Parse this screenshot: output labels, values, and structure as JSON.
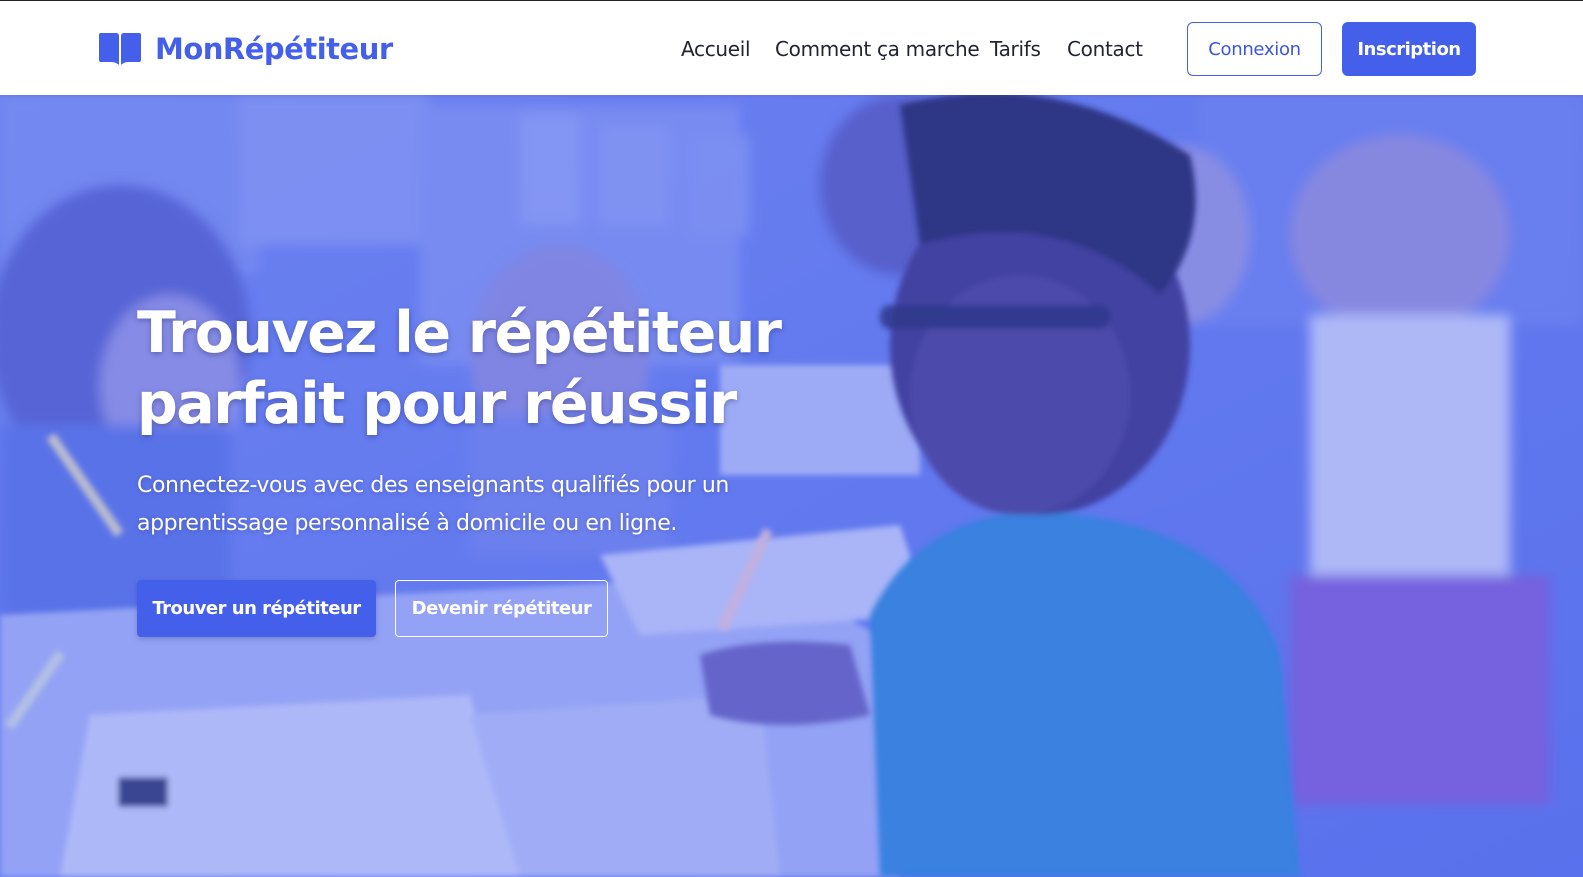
{
  "header": {
    "brand": "MonRépétiteur",
    "nav": [
      {
        "label": "Accueil"
      },
      {
        "label": "Comment ça marche"
      },
      {
        "label": "Tarifs"
      },
      {
        "label": "Contact"
      }
    ],
    "login_label": "Connexion",
    "signup_label": "Inscription"
  },
  "hero": {
    "title_line1": "Trouvez le répétiteur",
    "title_line2": "parfait pour réussir",
    "subtitle_line1": "Connectez-vous avec des enseignants qualifiés pour un",
    "subtitle_line2": "apprentissage personnalisé à domicile ou en ligne.",
    "primary_cta": "Trouver un répétiteur",
    "secondary_cta": "Devenir répétiteur"
  },
  "colors": {
    "accent": "#4460ea",
    "text_dark": "#1f2430",
    "hero_overlay": "#6e86ee"
  },
  "icons": {
    "logo": "open-book-icon"
  }
}
